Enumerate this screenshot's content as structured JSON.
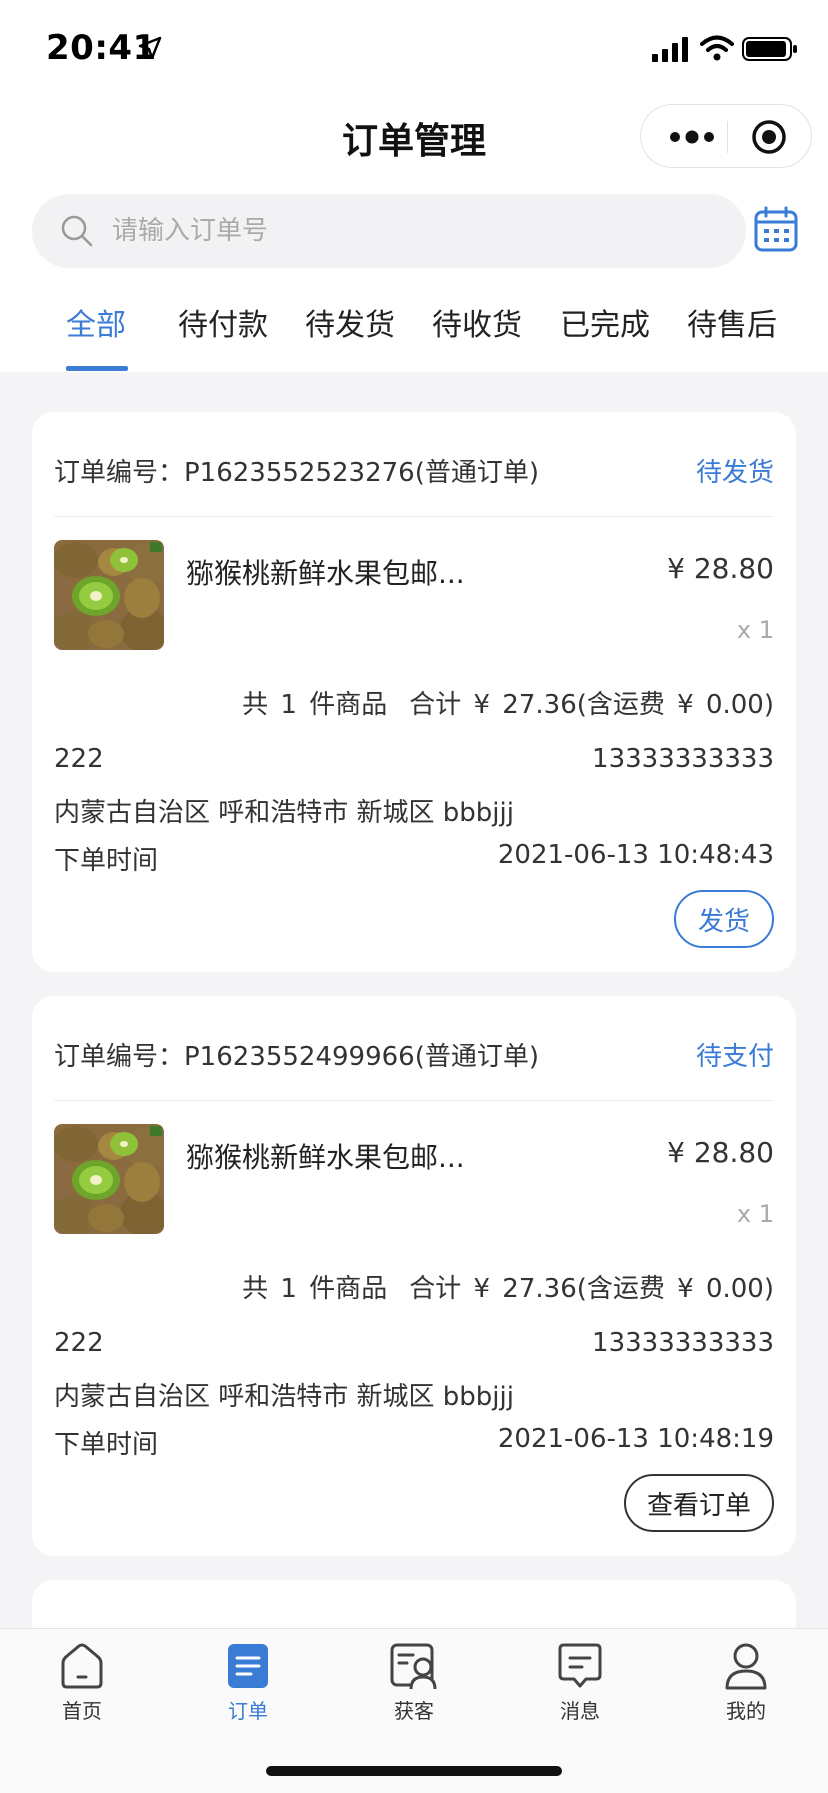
{
  "status_bar": {
    "time": "20:41"
  },
  "nav": {
    "title": "订单管理"
  },
  "search": {
    "placeholder": "请输入订单号"
  },
  "tabs": [
    {
      "label": "全部",
      "active": true
    },
    {
      "label": "待付款"
    },
    {
      "label": "待发货"
    },
    {
      "label": "待收货"
    },
    {
      "label": "已完成"
    },
    {
      "label": "待售后"
    }
  ],
  "orders": [
    {
      "order_no": "订单编号：P1623552523276(普通订单)",
      "status": "待发货",
      "product_name": "猕猴桃新鲜水果包邮...",
      "price": "¥ 28.80",
      "qty": "x 1",
      "count_text": "共 1 件商品",
      "total_text": "合计 ¥ 27.36(含运费 ¥ 0.00)",
      "recipient": "222",
      "phone": "13333333333",
      "address": "内蒙古自治区 呼和浩特市 新城区 bbbjjj",
      "time_label": "下单时间",
      "time_value": "2021-06-13 10:48:43",
      "action": "发货"
    },
    {
      "order_no": "订单编号：P1623552499966(普通订单)",
      "status": "待支付",
      "product_name": "猕猴桃新鲜水果包邮...",
      "price": "¥ 28.80",
      "qty": "x 1",
      "count_text": "共 1 件商品",
      "total_text": "合计 ¥ 27.36(含运费 ¥ 0.00)",
      "recipient": "222",
      "phone": "13333333333",
      "address": "内蒙古自治区 呼和浩特市 新城区 bbbjjj",
      "time_label": "下单时间",
      "time_value": "2021-06-13 10:48:19",
      "action": "查看订单"
    }
  ],
  "tabbar": [
    {
      "label": "首页",
      "icon": "home-icon"
    },
    {
      "label": "订单",
      "icon": "order-icon",
      "active": true
    },
    {
      "label": "获客",
      "icon": "customer-icon"
    },
    {
      "label": "消息",
      "icon": "message-icon"
    },
    {
      "label": "我的",
      "icon": "profile-icon"
    }
  ],
  "colors": {
    "accent": "#3a7bd5",
    "background": "#f4f4f6"
  }
}
